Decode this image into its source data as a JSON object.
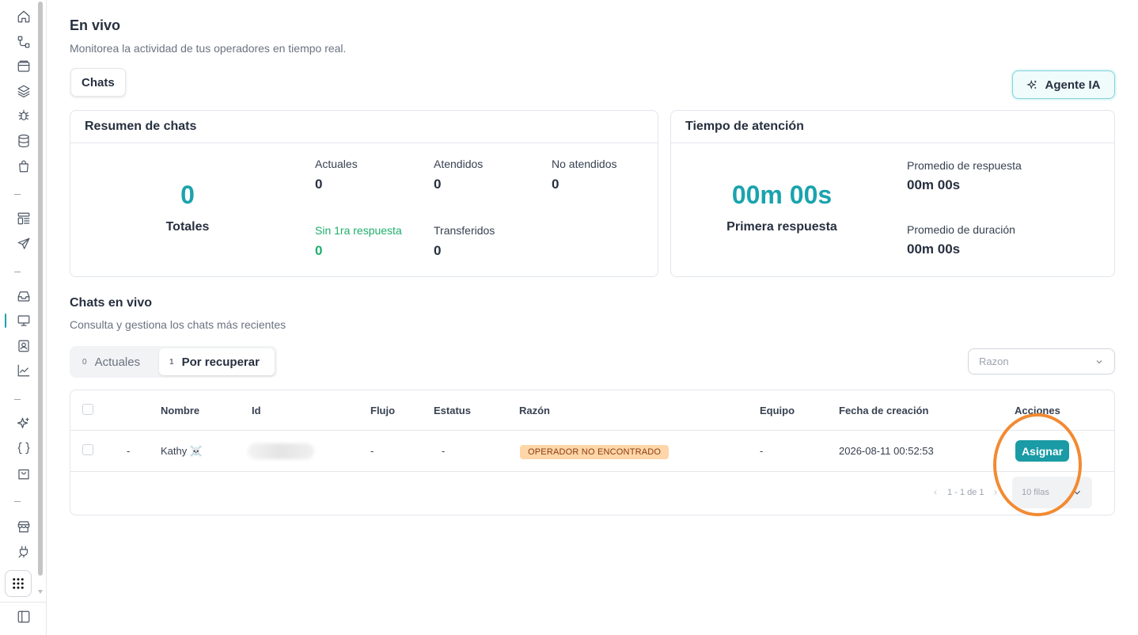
{
  "page": {
    "title": "En vivo",
    "subtitle": "Monitorea la actividad de tus operadores en tiempo real."
  },
  "top_tabs": {
    "chats_label": "Chats"
  },
  "agent_button": {
    "label": "Agente IA",
    "icon": "sparkles-icon"
  },
  "summary_card": {
    "title": "Resumen de chats",
    "total_value": "0",
    "total_label": "Totales",
    "stats": [
      {
        "label": "Actuales",
        "value": "0"
      },
      {
        "label": "Atendidos",
        "value": "0"
      },
      {
        "label": "No atendidos",
        "value": "0"
      },
      {
        "label": "Sin 1ra respuesta",
        "value": "0"
      },
      {
        "label": "Transferidos",
        "value": "0"
      }
    ]
  },
  "time_card": {
    "title": "Tiempo de atención",
    "main_value": "00m 00s",
    "main_label": "Primera respuesta",
    "stats": [
      {
        "label": "Promedio de respuesta",
        "value": "00m 00s"
      },
      {
        "label": "Promedio de duración",
        "value": "00m 00s"
      }
    ]
  },
  "live_chats": {
    "title": "Chats en vivo",
    "subtitle": "Consulta y gestiona los chats más recientes",
    "tabs": [
      {
        "count": "0",
        "label": "Actuales"
      },
      {
        "count": "1",
        "label": "Por recuperar"
      }
    ],
    "filter_placeholder": "Razon",
    "columns": [
      "Nombre",
      "Id",
      "Flujo",
      "Estatus",
      "Razón",
      "Equipo",
      "Fecha de creación",
      "Acciones"
    ],
    "rows": [
      {
        "prefix": "-",
        "nombre": "Kathy ☠️",
        "id": "",
        "flujo": "-",
        "estatus": "-",
        "razon": "OPERADOR NO ENCONTRADO",
        "equipo": "-",
        "fecha": "2026-08-11 00:52:53",
        "accion": "Asignar"
      }
    ],
    "pagination": {
      "range": "1 - 1 de 1",
      "rows_per_page": "10 filas"
    }
  },
  "colors": {
    "accent": "#1aa3ad",
    "badge_bg": "#ffd6a8",
    "highlight": "#f28a32",
    "green": "#1fae6b"
  }
}
